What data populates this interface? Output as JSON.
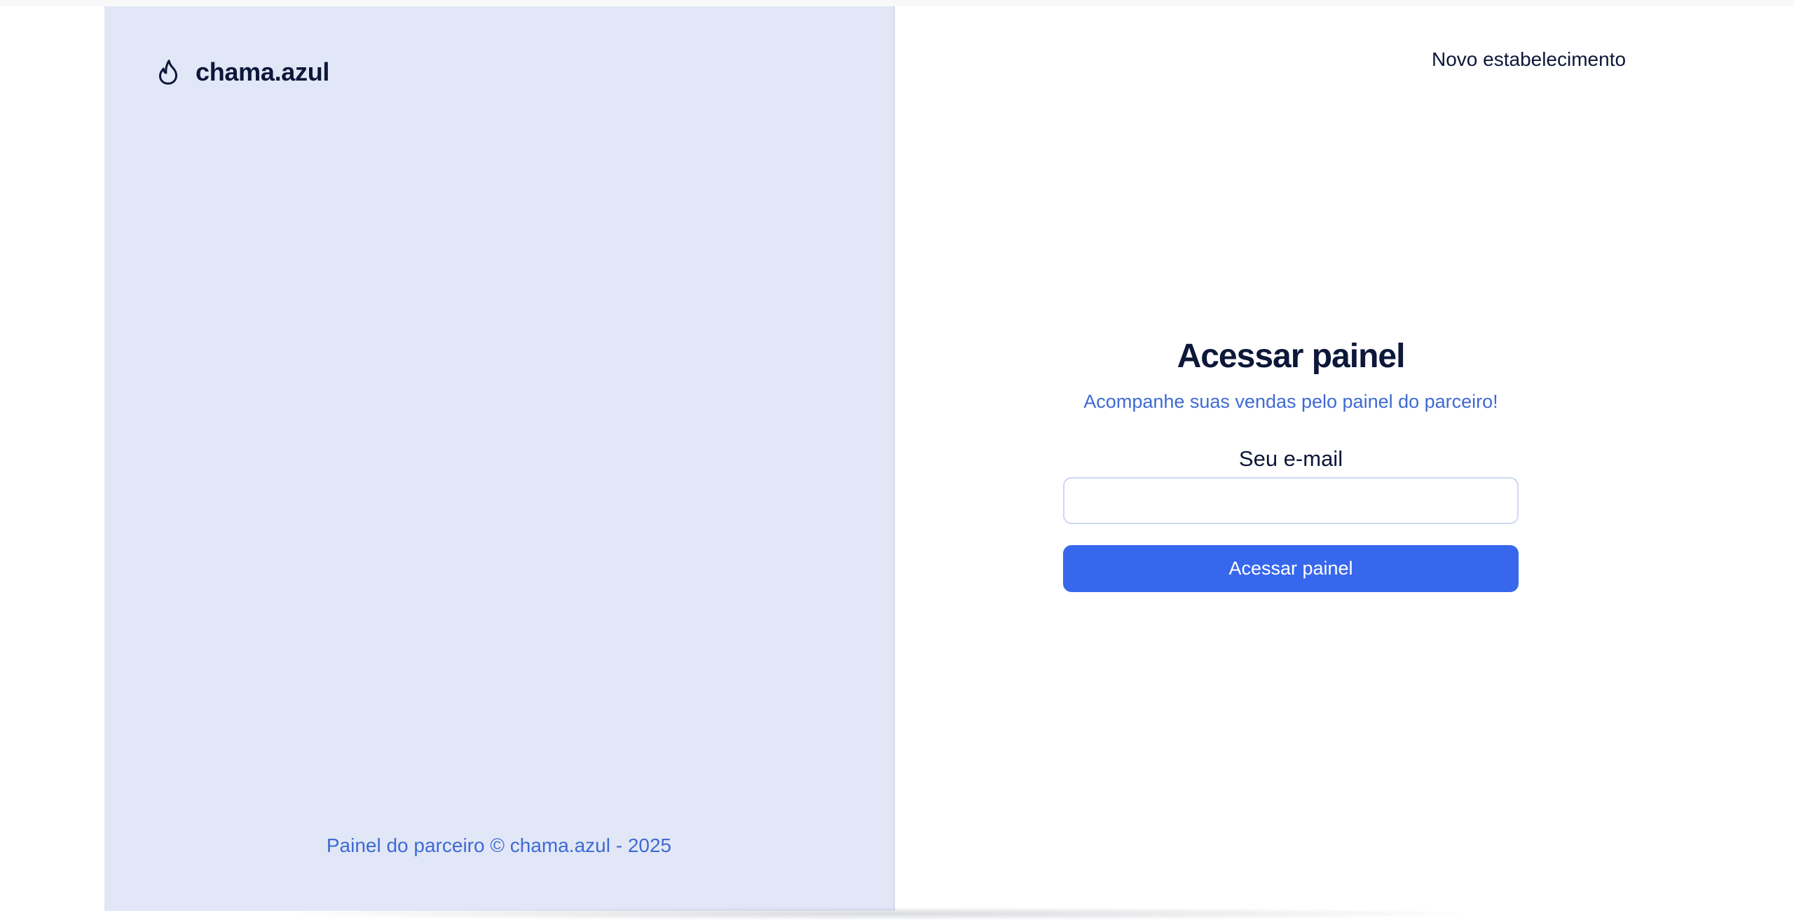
{
  "brand": {
    "name": "chama.azul",
    "icon": "flame-icon"
  },
  "header": {
    "new_establishment_link": "Novo estabelecimento"
  },
  "login": {
    "title": "Acessar painel",
    "subtitle": "Acompanhe suas vendas pelo painel do parceiro!",
    "email_label": "Seu e-mail",
    "email_value": "",
    "email_placeholder": "",
    "submit_label": "Acessar painel"
  },
  "footer": {
    "text": "Painel do parceiro © chama.azul - 2025"
  },
  "colors": {
    "left_panel_bg": "#e1e7f6",
    "primary": "#3767ec",
    "accent_text": "#3f6ad3",
    "dark_text": "#0c1739"
  }
}
